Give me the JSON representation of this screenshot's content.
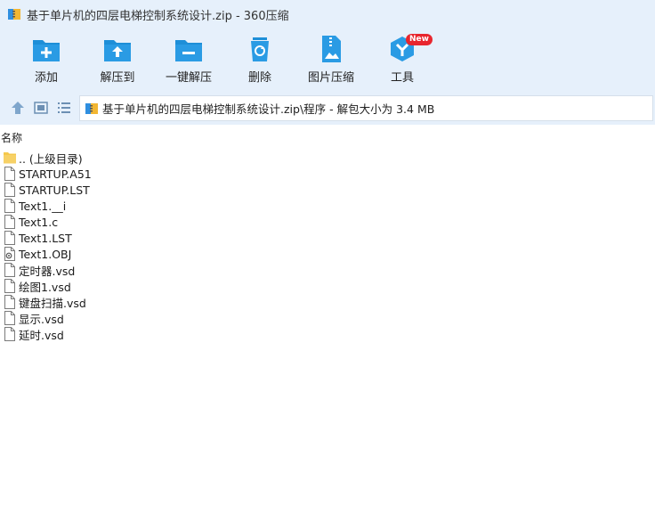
{
  "window": {
    "title": "基于单片机的四层电梯控制系统设计.zip - 360压缩"
  },
  "toolbar": {
    "items": [
      {
        "label": "添加",
        "icon": "add-folder-icon"
      },
      {
        "label": "解压到",
        "icon": "extract-to-icon"
      },
      {
        "label": "一键解压",
        "icon": "one-click-extract-icon"
      },
      {
        "label": "删除",
        "icon": "recycle-delete-icon"
      },
      {
        "label": "图片压缩",
        "icon": "image-compress-icon"
      },
      {
        "label": "工具",
        "icon": "tools-cube-icon",
        "badge": "New"
      }
    ]
  },
  "address": {
    "path": "基于单片机的四层电梯控制系统设计.zip\\程序 - 解包大小为 3.4 MB"
  },
  "list": {
    "column_name": "名称",
    "files": [
      {
        "name": ".. (上级目录)",
        "icon": "parent-folder-icon"
      },
      {
        "name": "STARTUP.A51",
        "icon": "file-icon"
      },
      {
        "name": "STARTUP.LST",
        "icon": "file-icon"
      },
      {
        "name": "Text1.__i",
        "icon": "file-icon"
      },
      {
        "name": "Text1.c",
        "icon": "file-icon"
      },
      {
        "name": "Text1.LST",
        "icon": "file-icon"
      },
      {
        "name": "Text1.OBJ",
        "icon": "obj-file-icon"
      },
      {
        "name": "定时器.vsd",
        "icon": "file-icon"
      },
      {
        "name": "绘图1.vsd",
        "icon": "file-icon"
      },
      {
        "name": "键盘扫描.vsd",
        "icon": "file-icon"
      },
      {
        "name": "显示.vsd",
        "icon": "file-icon"
      },
      {
        "name": "延时.vsd",
        "icon": "file-icon"
      }
    ]
  },
  "colors": {
    "toolbar_bg": "#e6f0fb",
    "icon_blue": "#1e8fd8",
    "folder_yellow": "#f5c84c",
    "badge_red": "#e8262e"
  }
}
